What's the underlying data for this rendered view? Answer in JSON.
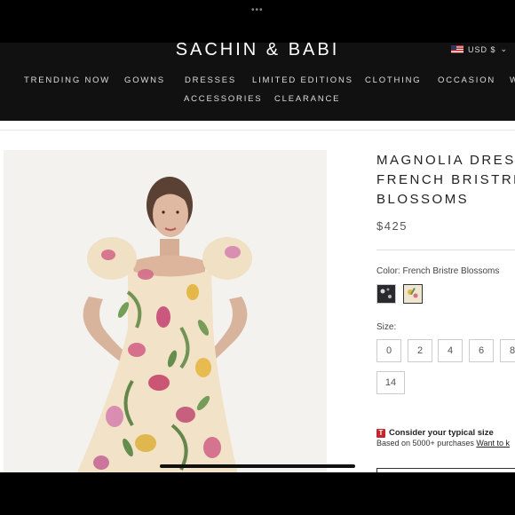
{
  "status": {
    "dots": "•••"
  },
  "header": {
    "brand": "SACHIN & BABI",
    "currency": "USD $",
    "currency_caret": "⌄",
    "nav_row1": [
      "TRENDING NOW",
      "GOWNS",
      "DRESSES",
      "LIMITED EDITIONS",
      "CLOTHING",
      "OCCASION",
      "W"
    ],
    "nav_row2": [
      "ACCESSORIES",
      "CLEARANCE"
    ]
  },
  "product": {
    "title_lines": [
      "MAGNOLIA DRESS",
      "FRENCH BRISTRE",
      "BLOSSOMS"
    ],
    "price": "$425",
    "color_label": "Color:",
    "color_value": "French Bristre Blossoms",
    "swatches": [
      {
        "name": "black-floral",
        "color": "#2a2a2e",
        "selected": false
      },
      {
        "name": "french-bristre-blossoms",
        "color": "#efe6cf",
        "selected": true
      }
    ],
    "size_label": "Size:",
    "sizes": [
      "0",
      "2",
      "4",
      "6",
      "8",
      "14"
    ],
    "fit_title": "Consider your typical size",
    "fit_icon": "T",
    "fit_sub": "Based on 5000+ purchases",
    "fit_link": "Want to k"
  },
  "colors": {
    "header_bg": "#111111",
    "accent_red": "#c4262e"
  }
}
